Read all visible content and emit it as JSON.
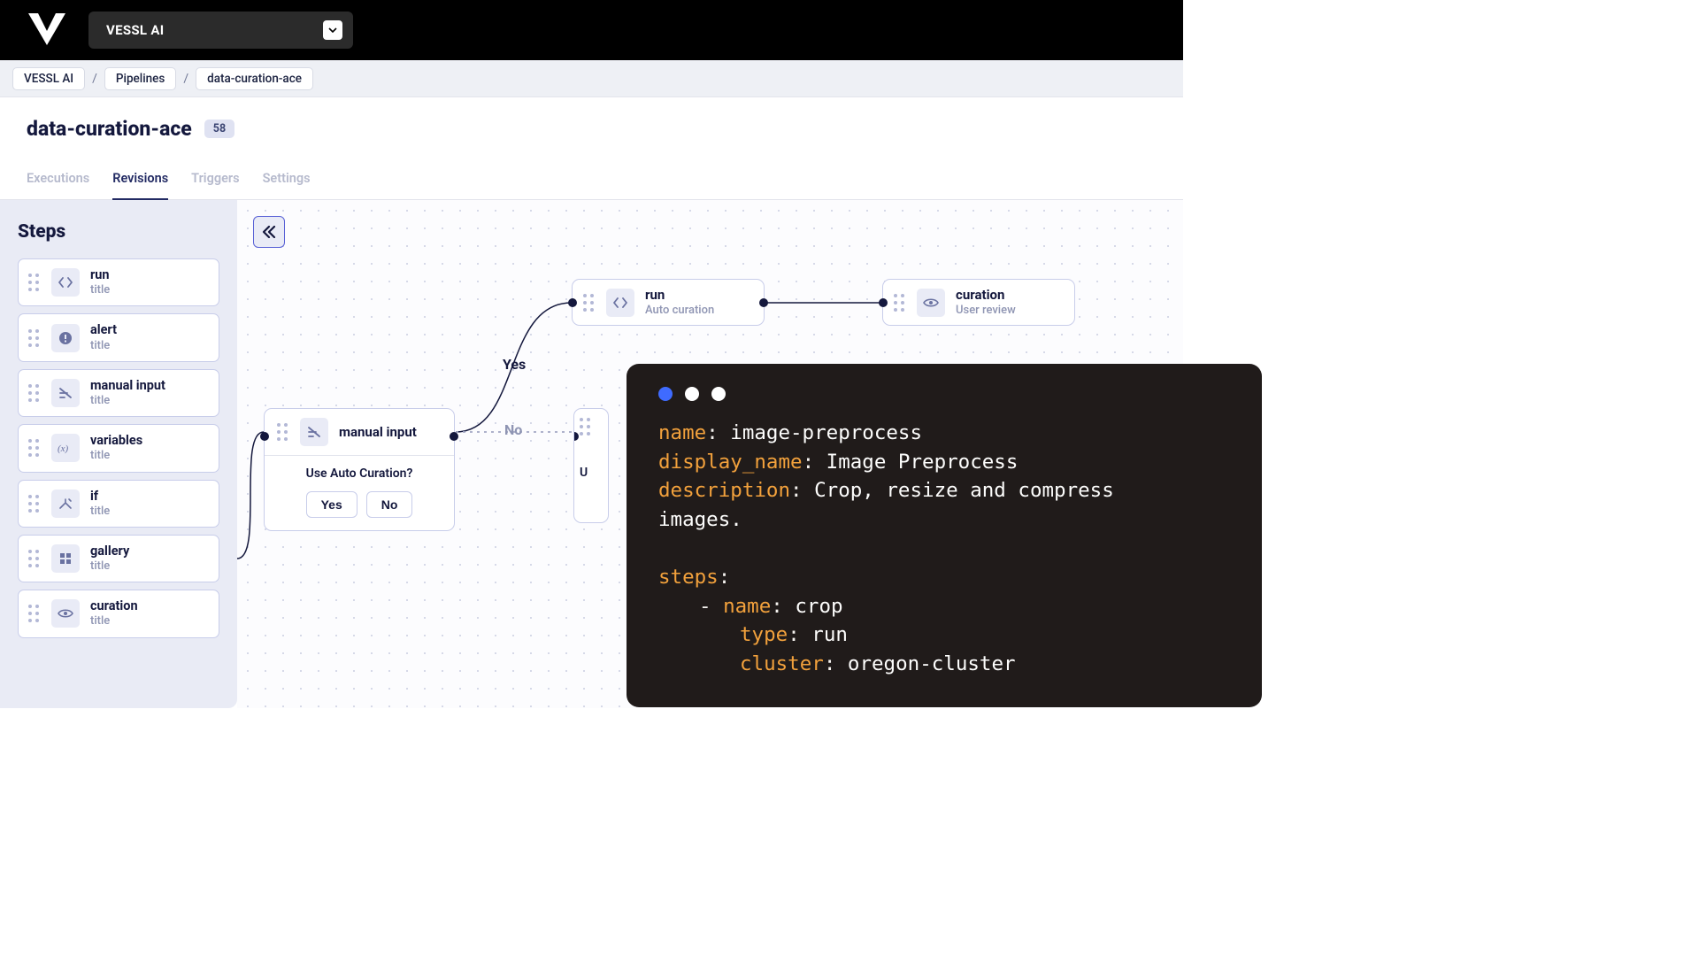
{
  "header": {
    "org_name": "VESSL AI"
  },
  "breadcrumbs": [
    "VESSL AI",
    "Pipelines",
    "data-curation-ace"
  ],
  "page": {
    "title": "data-curation-ace",
    "count": "58"
  },
  "tabs": [
    "Executions",
    "Revisions",
    "Triggers",
    "Settings"
  ],
  "active_tab": 1,
  "sidebar": {
    "title": "Steps",
    "items": [
      {
        "name": "run",
        "subtitle": "title",
        "icon": "code-icon"
      },
      {
        "name": "alert",
        "subtitle": "title",
        "icon": "alert-icon"
      },
      {
        "name": "manual input",
        "subtitle": "title",
        "icon": "input-icon"
      },
      {
        "name": "variables",
        "subtitle": "title",
        "icon": "variable-icon"
      },
      {
        "name": "if",
        "subtitle": "title",
        "icon": "branch-icon"
      },
      {
        "name": "gallery",
        "subtitle": "title",
        "icon": "grid-icon"
      },
      {
        "name": "curation",
        "subtitle": "title",
        "icon": "eye-icon"
      }
    ]
  },
  "canvas": {
    "edge_labels": {
      "yes": "Yes",
      "no": "No"
    },
    "nodes": {
      "manual": {
        "type": "manual input",
        "question": "Use Auto Curation?",
        "yes": "Yes",
        "no": "No"
      },
      "run_auto": {
        "type": "run",
        "subtitle": "Auto curation"
      },
      "curation_user": {
        "type": "curation",
        "subtitle": "User review"
      },
      "hidden_u": "U"
    }
  },
  "code": {
    "lines": [
      {
        "segments": [
          {
            "k": "key",
            "t": "name"
          },
          {
            "t": ": "
          },
          {
            "k": "val",
            "t": "image-preprocess"
          }
        ]
      },
      {
        "segments": [
          {
            "k": "key",
            "t": "display_name"
          },
          {
            "t": ": "
          },
          {
            "k": "val",
            "t": "Image Preprocess"
          }
        ]
      },
      {
        "segments": [
          {
            "k": "key",
            "t": "description"
          },
          {
            "t": ": "
          },
          {
            "k": "val",
            "t": "Crop, resize and compress"
          }
        ]
      },
      {
        "segments": [
          {
            "k": "val",
            "t": "images."
          }
        ]
      },
      {
        "blank": true
      },
      {
        "segments": [
          {
            "k": "key",
            "t": "steps"
          },
          {
            "t": ":"
          }
        ]
      },
      {
        "indent": 1,
        "segments": [
          {
            "t": "- "
          },
          {
            "k": "key",
            "t": "name"
          },
          {
            "t": ": "
          },
          {
            "k": "val",
            "t": "crop"
          }
        ]
      },
      {
        "indent": 2,
        "segments": [
          {
            "k": "key",
            "t": "type"
          },
          {
            "t": ": "
          },
          {
            "k": "val",
            "t": "run"
          }
        ]
      },
      {
        "indent": 2,
        "segments": [
          {
            "k": "key",
            "t": "cluster"
          },
          {
            "t": ": "
          },
          {
            "k": "val",
            "t": "oregon-cluster"
          }
        ]
      }
    ]
  }
}
